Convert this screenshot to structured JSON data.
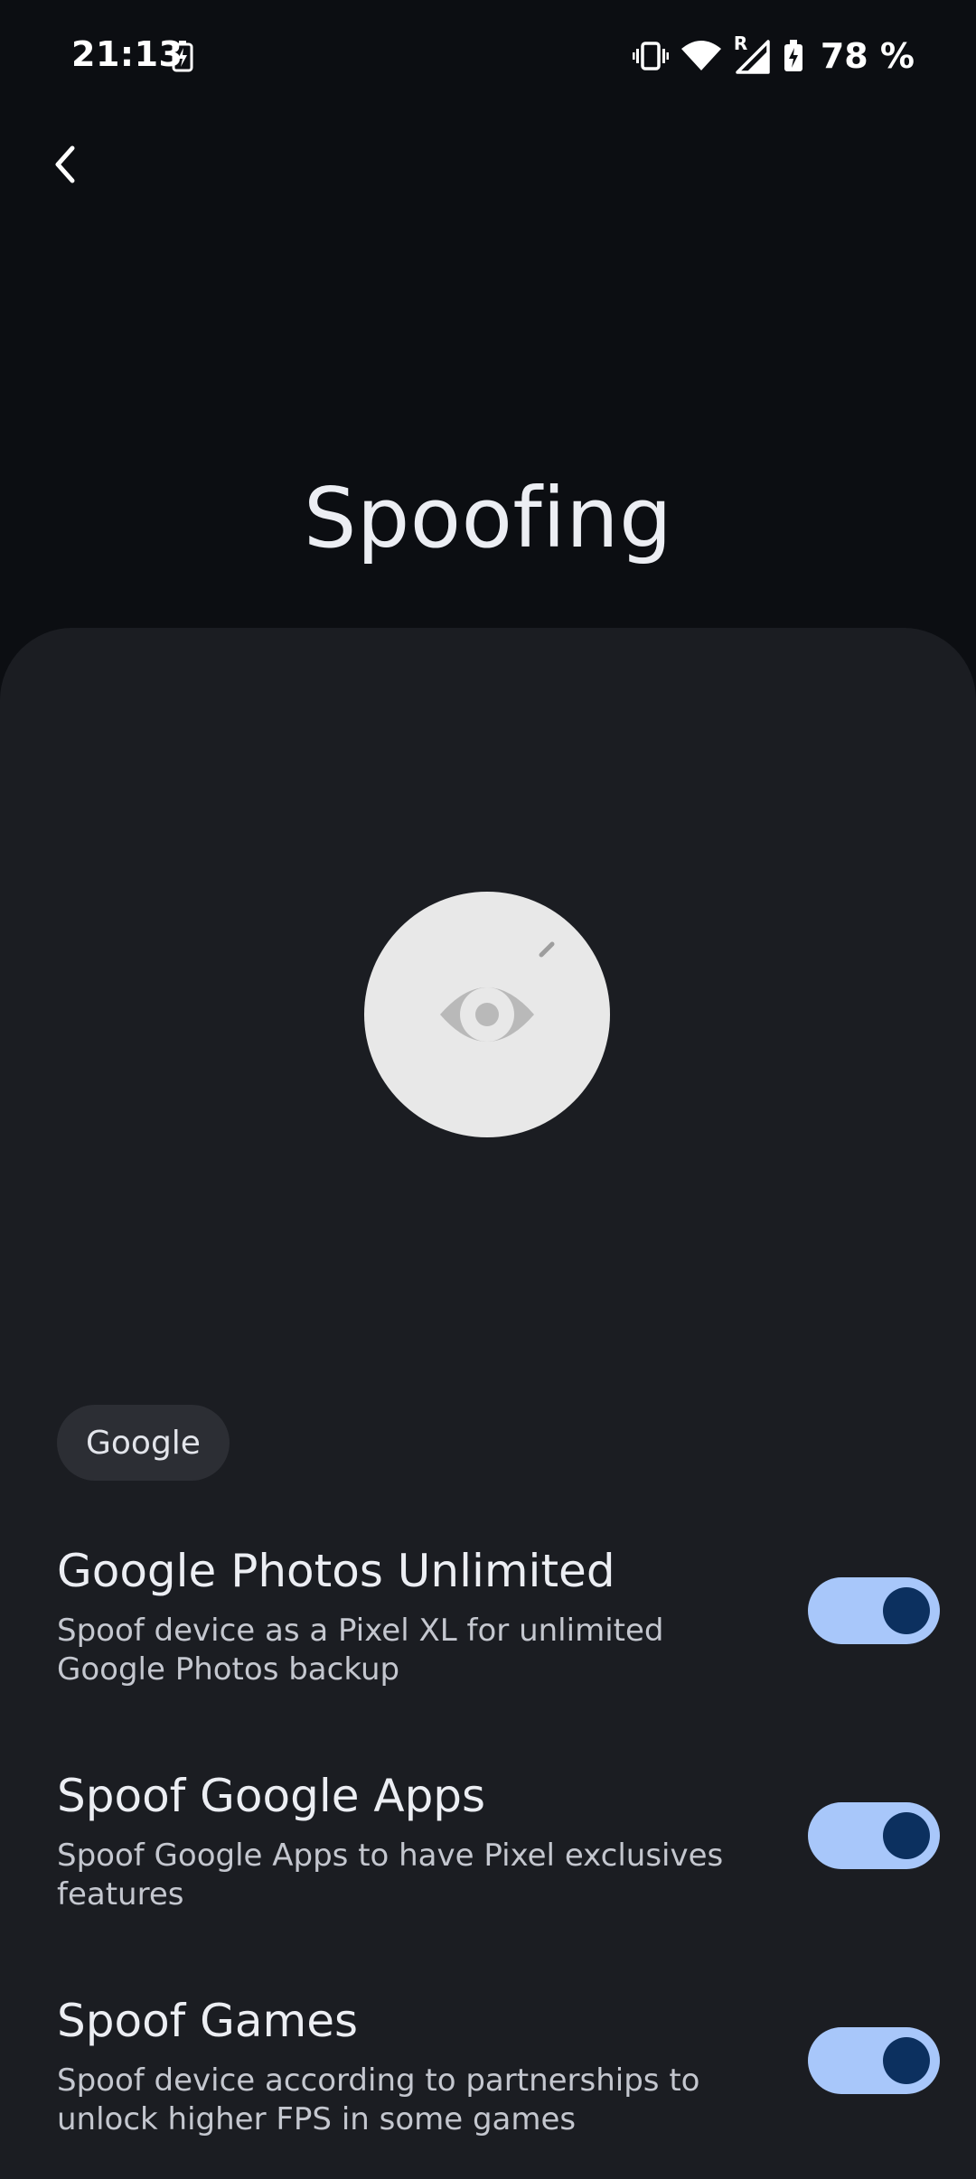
{
  "status_bar": {
    "time": "21:13",
    "battery_percent": "78 %",
    "roaming_indicator": "R",
    "icons": [
      "battery-charging-icon",
      "vibrate-icon",
      "wifi-icon",
      "cell-signal-icon",
      "battery-icon"
    ]
  },
  "header": {
    "title": "Spoofing",
    "back_icon": "chevron-left-icon"
  },
  "hero": {
    "icon": "eye-icon"
  },
  "category": {
    "label": "Google"
  },
  "settings": [
    {
      "title": "Google Photos Unlimited",
      "summary": "Spoof device as a Pixel XL for unlimited Google Photos backup",
      "enabled": true
    },
    {
      "title": "Spoof Google Apps",
      "summary": "Spoof Google Apps to have Pixel exclusives features",
      "enabled": true
    },
    {
      "title": "Spoof Games",
      "summary": "Spoof device according to partnerships to unlock higher FPS in some games",
      "enabled": true
    }
  ],
  "colors": {
    "background": "#0c0e12",
    "card": "#1b1d22",
    "switch_track": "#a8c7fa",
    "switch_thumb": "#0c305f",
    "chip": "#2c2e34"
  }
}
